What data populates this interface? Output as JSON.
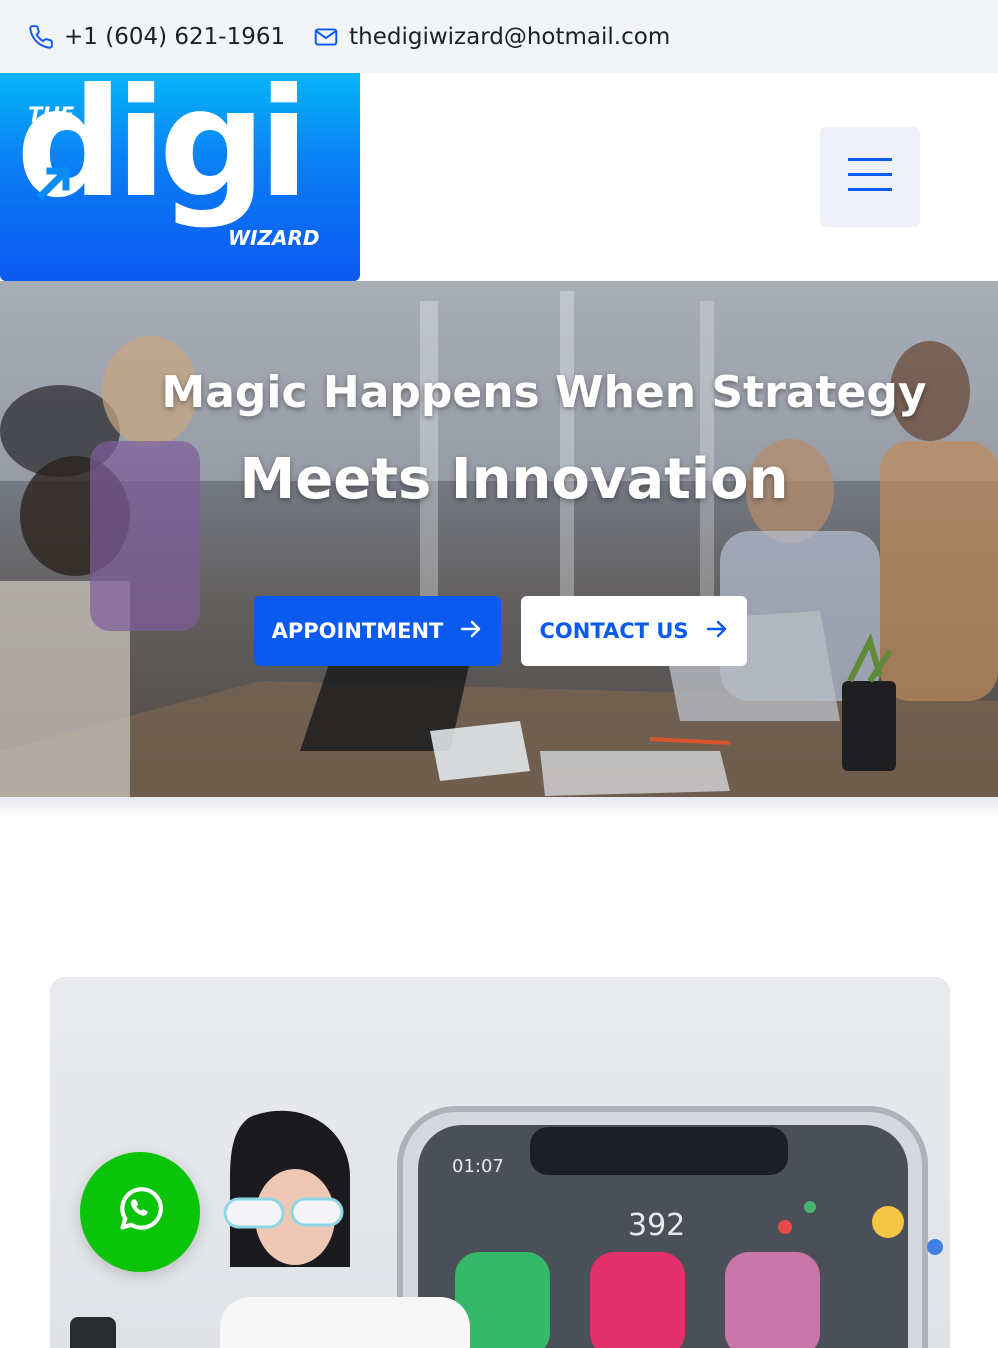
{
  "topbar": {
    "phone": "+1 (604) 621-1961",
    "email": "thedigiwizard@hotmail.com",
    "phone_icon": "phone-icon",
    "email_icon": "mail-icon"
  },
  "header": {
    "logo": {
      "the": "THE",
      "digi": "digi",
      "wizard": "WIZARD"
    },
    "menu_icon": "hamburger-icon"
  },
  "hero": {
    "title_line1": "Magic Happens When Strategy",
    "title_line2": "Meets Innovation",
    "buttons": [
      {
        "label": "APPOINTMENT",
        "icon": "arrow-right-icon"
      },
      {
        "label": "CONTACT US",
        "icon": "arrow-right-icon"
      }
    ]
  },
  "feature": {
    "phone_screen": {
      "status": "01:07",
      "time": "392"
    }
  },
  "floating": {
    "whatsapp_icon": "whatsapp-icon"
  },
  "colors": {
    "brand_blue": "#0b5af0",
    "logo_gradient_top": "#05b4f7",
    "whatsapp_green": "#0ac40a",
    "topbar_bg": "#f3f4f8"
  }
}
